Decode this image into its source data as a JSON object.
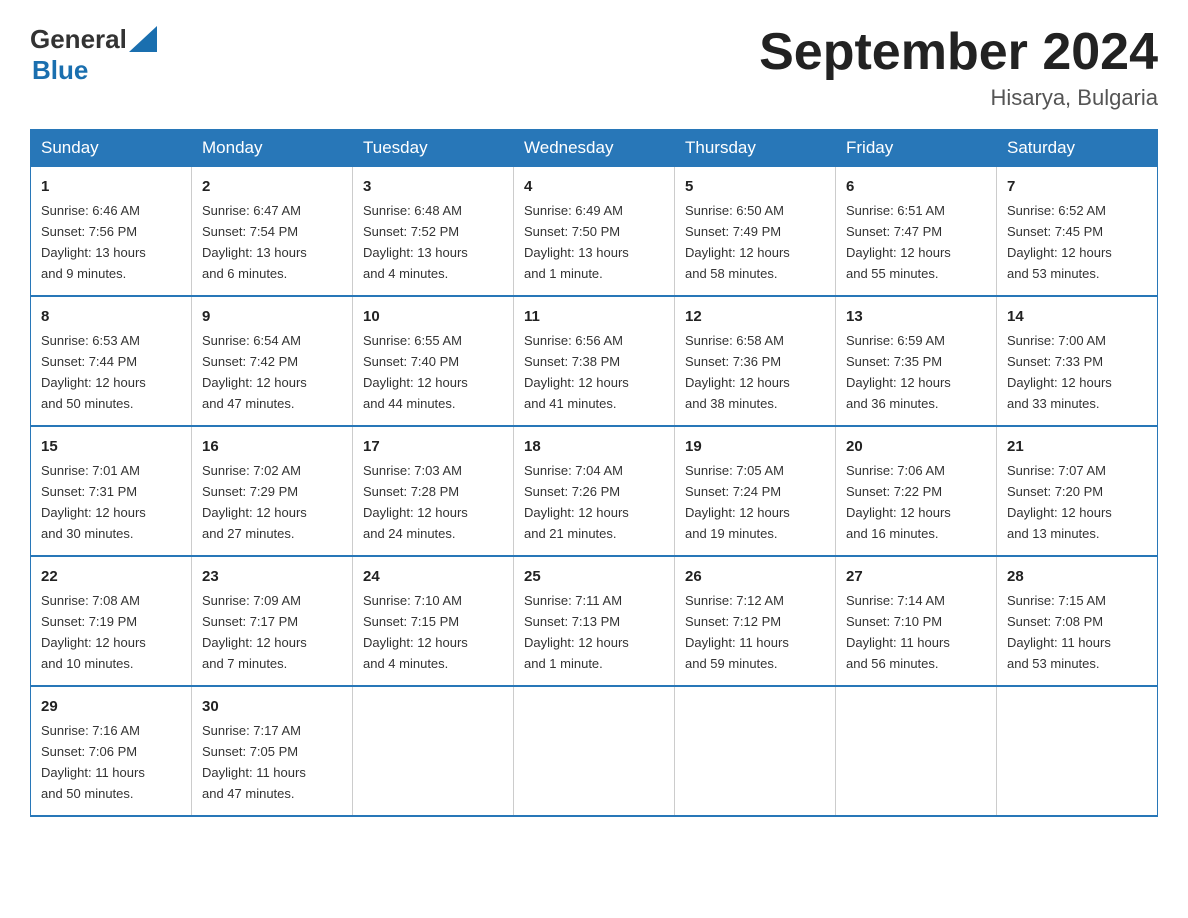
{
  "header": {
    "logo": {
      "general": "General",
      "blue": "Blue",
      "tagline": "GeneralBlue"
    },
    "title": "September 2024",
    "subtitle": "Hisarya, Bulgaria"
  },
  "weekdays": [
    "Sunday",
    "Monday",
    "Tuesday",
    "Wednesday",
    "Thursday",
    "Friday",
    "Saturday"
  ],
  "weeks": [
    [
      {
        "day": "1",
        "info": "Sunrise: 6:46 AM\nSunset: 7:56 PM\nDaylight: 13 hours\nand 9 minutes."
      },
      {
        "day": "2",
        "info": "Sunrise: 6:47 AM\nSunset: 7:54 PM\nDaylight: 13 hours\nand 6 minutes."
      },
      {
        "day": "3",
        "info": "Sunrise: 6:48 AM\nSunset: 7:52 PM\nDaylight: 13 hours\nand 4 minutes."
      },
      {
        "day": "4",
        "info": "Sunrise: 6:49 AM\nSunset: 7:50 PM\nDaylight: 13 hours\nand 1 minute."
      },
      {
        "day": "5",
        "info": "Sunrise: 6:50 AM\nSunset: 7:49 PM\nDaylight: 12 hours\nand 58 minutes."
      },
      {
        "day": "6",
        "info": "Sunrise: 6:51 AM\nSunset: 7:47 PM\nDaylight: 12 hours\nand 55 minutes."
      },
      {
        "day": "7",
        "info": "Sunrise: 6:52 AM\nSunset: 7:45 PM\nDaylight: 12 hours\nand 53 minutes."
      }
    ],
    [
      {
        "day": "8",
        "info": "Sunrise: 6:53 AM\nSunset: 7:44 PM\nDaylight: 12 hours\nand 50 minutes."
      },
      {
        "day": "9",
        "info": "Sunrise: 6:54 AM\nSunset: 7:42 PM\nDaylight: 12 hours\nand 47 minutes."
      },
      {
        "day": "10",
        "info": "Sunrise: 6:55 AM\nSunset: 7:40 PM\nDaylight: 12 hours\nand 44 minutes."
      },
      {
        "day": "11",
        "info": "Sunrise: 6:56 AM\nSunset: 7:38 PM\nDaylight: 12 hours\nand 41 minutes."
      },
      {
        "day": "12",
        "info": "Sunrise: 6:58 AM\nSunset: 7:36 PM\nDaylight: 12 hours\nand 38 minutes."
      },
      {
        "day": "13",
        "info": "Sunrise: 6:59 AM\nSunset: 7:35 PM\nDaylight: 12 hours\nand 36 minutes."
      },
      {
        "day": "14",
        "info": "Sunrise: 7:00 AM\nSunset: 7:33 PM\nDaylight: 12 hours\nand 33 minutes."
      }
    ],
    [
      {
        "day": "15",
        "info": "Sunrise: 7:01 AM\nSunset: 7:31 PM\nDaylight: 12 hours\nand 30 minutes."
      },
      {
        "day": "16",
        "info": "Sunrise: 7:02 AM\nSunset: 7:29 PM\nDaylight: 12 hours\nand 27 minutes."
      },
      {
        "day": "17",
        "info": "Sunrise: 7:03 AM\nSunset: 7:28 PM\nDaylight: 12 hours\nand 24 minutes."
      },
      {
        "day": "18",
        "info": "Sunrise: 7:04 AM\nSunset: 7:26 PM\nDaylight: 12 hours\nand 21 minutes."
      },
      {
        "day": "19",
        "info": "Sunrise: 7:05 AM\nSunset: 7:24 PM\nDaylight: 12 hours\nand 19 minutes."
      },
      {
        "day": "20",
        "info": "Sunrise: 7:06 AM\nSunset: 7:22 PM\nDaylight: 12 hours\nand 16 minutes."
      },
      {
        "day": "21",
        "info": "Sunrise: 7:07 AM\nSunset: 7:20 PM\nDaylight: 12 hours\nand 13 minutes."
      }
    ],
    [
      {
        "day": "22",
        "info": "Sunrise: 7:08 AM\nSunset: 7:19 PM\nDaylight: 12 hours\nand 10 minutes."
      },
      {
        "day": "23",
        "info": "Sunrise: 7:09 AM\nSunset: 7:17 PM\nDaylight: 12 hours\nand 7 minutes."
      },
      {
        "day": "24",
        "info": "Sunrise: 7:10 AM\nSunset: 7:15 PM\nDaylight: 12 hours\nand 4 minutes."
      },
      {
        "day": "25",
        "info": "Sunrise: 7:11 AM\nSunset: 7:13 PM\nDaylight: 12 hours\nand 1 minute."
      },
      {
        "day": "26",
        "info": "Sunrise: 7:12 AM\nSunset: 7:12 PM\nDaylight: 11 hours\nand 59 minutes."
      },
      {
        "day": "27",
        "info": "Sunrise: 7:14 AM\nSunset: 7:10 PM\nDaylight: 11 hours\nand 56 minutes."
      },
      {
        "day": "28",
        "info": "Sunrise: 7:15 AM\nSunset: 7:08 PM\nDaylight: 11 hours\nand 53 minutes."
      }
    ],
    [
      {
        "day": "29",
        "info": "Sunrise: 7:16 AM\nSunset: 7:06 PM\nDaylight: 11 hours\nand 50 minutes."
      },
      {
        "day": "30",
        "info": "Sunrise: 7:17 AM\nSunset: 7:05 PM\nDaylight: 11 hours\nand 47 minutes."
      },
      {
        "day": "",
        "info": ""
      },
      {
        "day": "",
        "info": ""
      },
      {
        "day": "",
        "info": ""
      },
      {
        "day": "",
        "info": ""
      },
      {
        "day": "",
        "info": ""
      }
    ]
  ]
}
